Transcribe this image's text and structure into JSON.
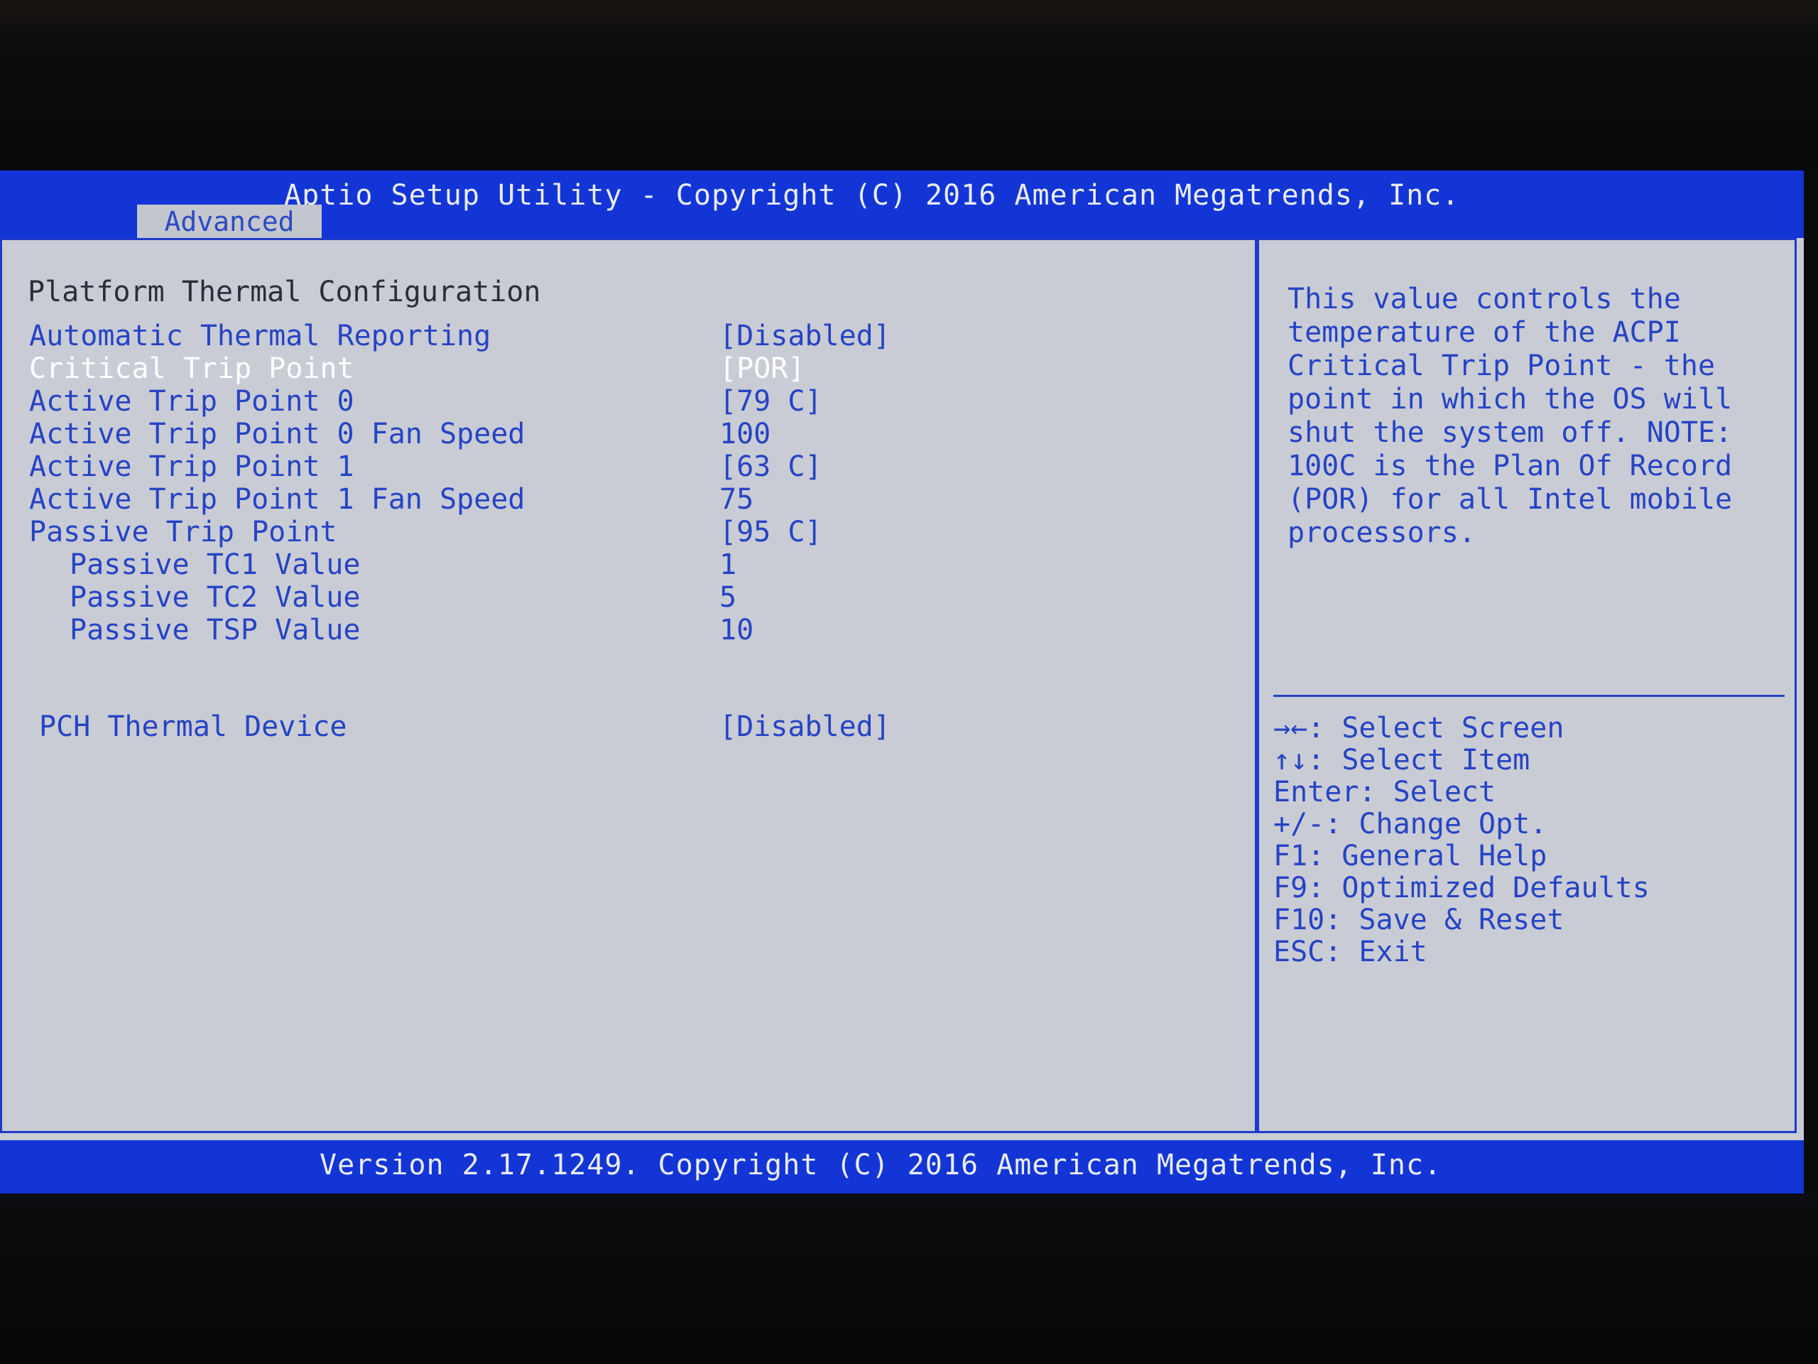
{
  "header": {
    "title": "Aptio Setup Utility - Copyright (C) 2016 American Megatrends, Inc.",
    "active_tab": "Advanced"
  },
  "page": {
    "section_title": "Platform Thermal Configuration"
  },
  "settings": [
    {
      "label": "Automatic Thermal Reporting",
      "value": "[Disabled]"
    },
    {
      "label": "Critical Trip Point",
      "value": "[POR]"
    },
    {
      "label": "Active Trip Point 0",
      "value": "[79 C]"
    },
    {
      "label": "Active Trip Point 0 Fan Speed",
      "value": "100"
    },
    {
      "label": "Active Trip Point 1",
      "value": "[63 C]"
    },
    {
      "label": "Active Trip Point 1 Fan Speed",
      "value": "75"
    },
    {
      "label": "Passive Trip Point",
      "value": "[95 C]"
    },
    {
      "label": "Passive TC1 Value",
      "value": "1"
    },
    {
      "label": "Passive TC2 Value",
      "value": "5"
    },
    {
      "label": "Passive TSP Value",
      "value": "10"
    },
    {
      "label": "PCH Thermal Device",
      "value": "[Disabled]"
    }
  ],
  "selected_setting": "Critical Trip Point",
  "help": {
    "text": "This value controls the temperature of the ACPI Critical Trip Point - the point in which the OS will shut the system off. NOTE: 100C is the Plan Of Record (POR) for all Intel mobile processors."
  },
  "keys": [
    "→←: Select Screen",
    "↑↓: Select Item",
    "Enter: Select",
    "+/-: Change Opt.",
    "F1: General Help",
    "F9: Optimized Defaults",
    "F10: Save & Reset",
    "ESC: Exit"
  ],
  "footer": {
    "text": "Version 2.17.1249. Copyright (C) 2016 American Megatrends, Inc."
  },
  "colors": {
    "bar_blue": "#1335d6",
    "panel_gray": "#c9ccd4",
    "text_blue": "#2643c5",
    "highlight_white": "#ffffff"
  }
}
